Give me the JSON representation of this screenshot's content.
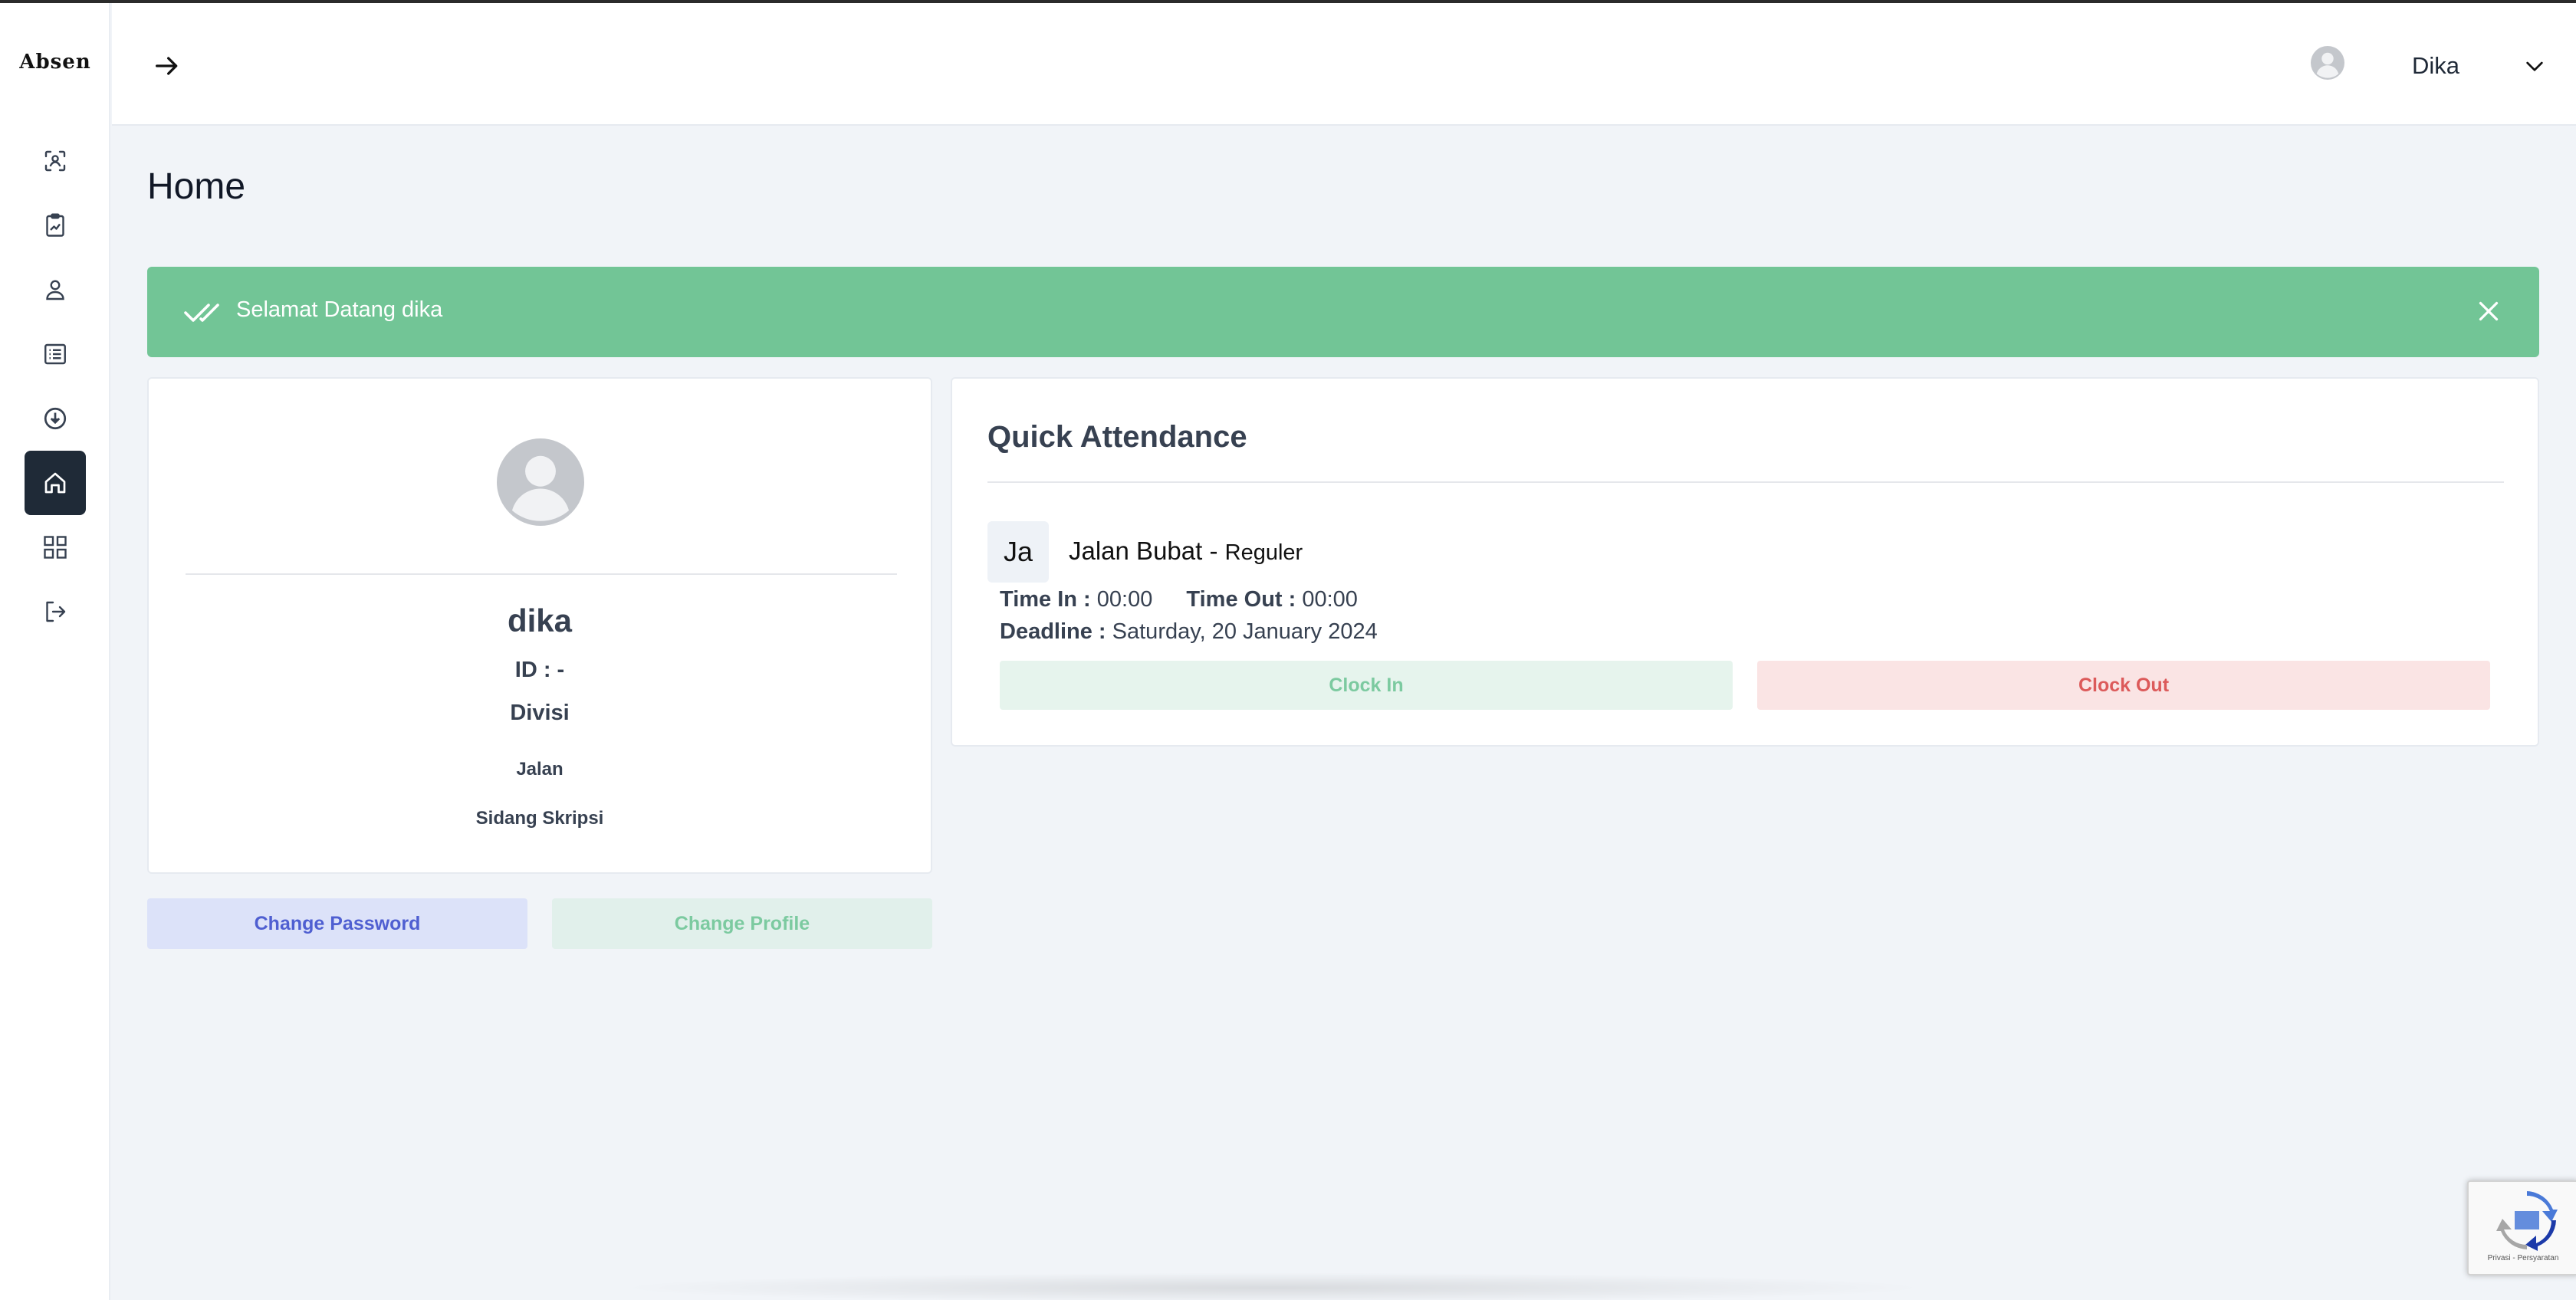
{
  "app": {
    "logo_text": "Absen"
  },
  "sidebar": {
    "items": [
      {
        "name": "scan",
        "icon": "scan-face-icon",
        "active": false
      },
      {
        "name": "report",
        "icon": "chart-clipboard-icon",
        "active": false
      },
      {
        "name": "profile",
        "icon": "user-icon",
        "active": false
      },
      {
        "name": "list",
        "icon": "list-icon",
        "active": false
      },
      {
        "name": "download",
        "icon": "download-circle-icon",
        "active": false
      },
      {
        "name": "home",
        "icon": "home-icon",
        "active": true
      },
      {
        "name": "apps",
        "icon": "grid-icon",
        "active": false
      },
      {
        "name": "logout",
        "icon": "logout-icon",
        "active": false
      }
    ]
  },
  "header": {
    "collapse_icon": "arrow-right-icon",
    "user_name": "Dika",
    "chevron_icon": "chevron-down-icon"
  },
  "page": {
    "title": "Home"
  },
  "alert": {
    "message": "Selamat Datang dika",
    "color": "#72c596"
  },
  "profile": {
    "name": "dika",
    "id_label": "ID :",
    "id_value": "-",
    "division": "Divisi",
    "line1": "Jalan",
    "line2": "Sidang Skripsi"
  },
  "actions": {
    "change_password": "Change Password",
    "change_profile": "Change Profile"
  },
  "quick_attendance": {
    "title": "Quick Attendance",
    "badge": "Ja",
    "location_name": "Jalan Bubat - ",
    "location_type": "Reguler",
    "time_in_label": "Time In :",
    "time_in_value": "00:00",
    "time_out_label": "Time Out :",
    "time_out_value": "00:00",
    "deadline_label": "Deadline :",
    "deadline_value": "Saturday, 20 January 2024",
    "clock_in": "Clock In",
    "clock_out": "Clock Out"
  },
  "recaptcha": {
    "text": "Privasi - Persyaratan"
  }
}
